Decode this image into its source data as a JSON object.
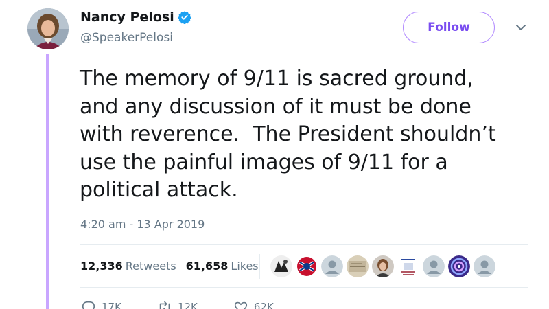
{
  "author": {
    "display_name": "Nancy Pelosi",
    "handle": "@SpeakerPelosi",
    "verified": true
  },
  "follow_button": {
    "label": "Follow"
  },
  "tweet": {
    "text": "The memory of 9/11 is sacred ground,\nand any discussion of it must be done\nwith reverence.  The President shouldn’t\nuse the painful images of 9/11 for a\npolitical attack.",
    "timestamp": "4:20 am - 13 Apr 2019"
  },
  "stats": {
    "retweets_count": "12,336",
    "retweets_label": "Retweets",
    "likes_count": "61,658",
    "likes_label": "Likes"
  },
  "liker_avatars": [
    "liker-photo-1",
    "liker-photo-2",
    "default-avatar-icon",
    "liker-photo-3",
    "liker-photo-4",
    "liker-photo-5",
    "default-avatar-icon",
    "liker-photo-6",
    "default-avatar-icon"
  ],
  "actions": {
    "reply_count": "17K",
    "retweet_count": "12K",
    "like_count": "62K"
  },
  "colors": {
    "accent": "#7a4df0",
    "thread_line": "#c9a6ff",
    "verified": "#1da1f2",
    "muted_text": "#657786"
  }
}
